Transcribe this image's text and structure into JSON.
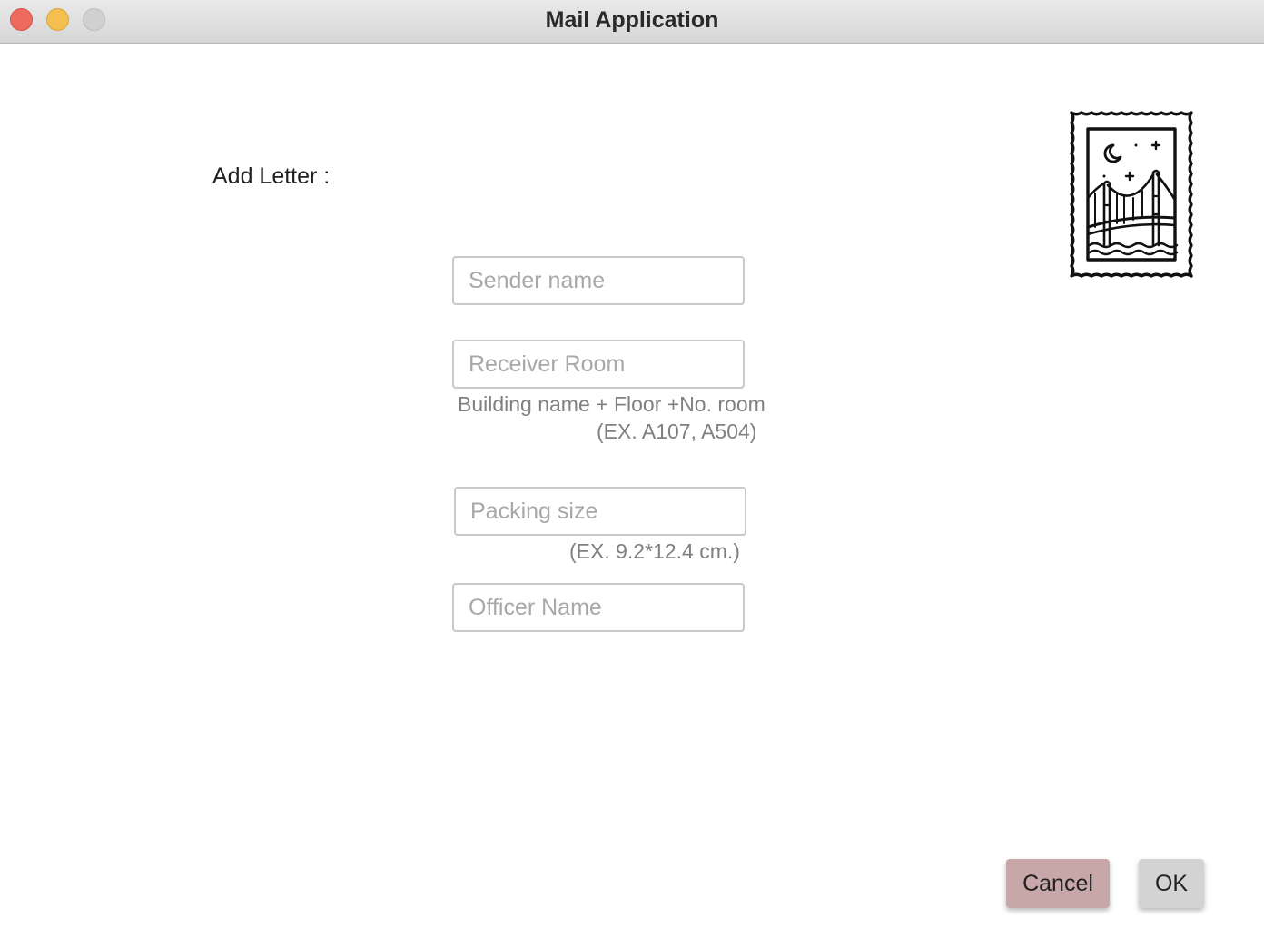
{
  "window": {
    "title": "Mail Application"
  },
  "form": {
    "section_label": "Add Letter :",
    "sender": {
      "placeholder": "Sender name",
      "value": ""
    },
    "receiver": {
      "placeholder": "Receiver Room",
      "value": "",
      "hint_line1": "Building name + Floor +No. room",
      "hint_line2": "(EX.  A107, A504)"
    },
    "packing": {
      "placeholder": "Packing size",
      "value": "",
      "hint": "(EX.   9.2*12.4 cm.)"
    },
    "officer": {
      "placeholder": "Officer Name",
      "value": ""
    }
  },
  "buttons": {
    "cancel_label": "Cancel",
    "ok_label": "OK"
  },
  "icons": {
    "stamp": "postage-stamp-bridge-icon"
  },
  "colors": {
    "cancel_button": "#c7a7a7",
    "ok_button": "#d3d3d3",
    "close_light": "#ed6a5e",
    "minimize_light": "#f5bf4f",
    "zoom_light": "#d0d0d0"
  }
}
